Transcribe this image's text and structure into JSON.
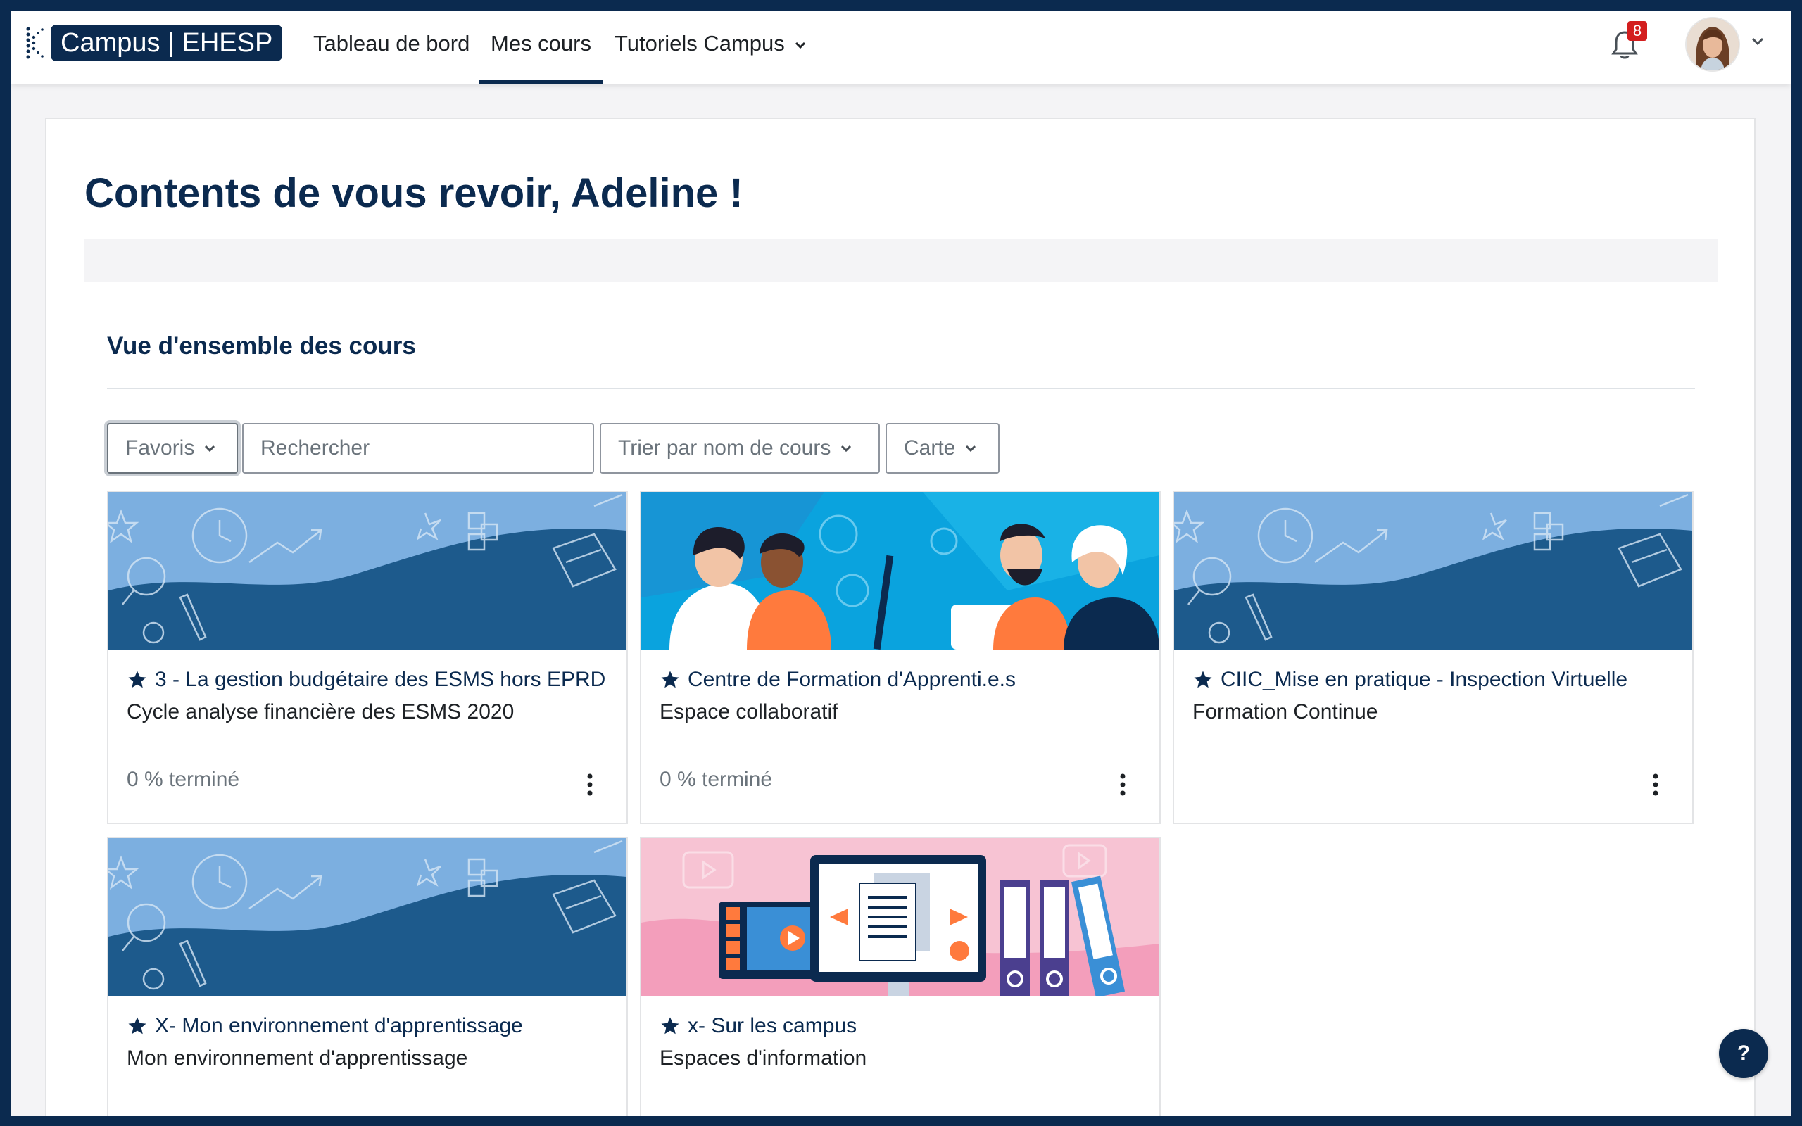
{
  "brand": {
    "logo_text": "Campus | EHESP"
  },
  "nav": {
    "items": [
      {
        "label": "Tableau de bord"
      },
      {
        "label": "Mes cours"
      },
      {
        "label": "Tutoriels Campus"
      }
    ],
    "notifications_count": "8"
  },
  "main": {
    "greeting": "Contents de vous revoir, Adeline !",
    "section_title": "Vue d'ensemble des cours",
    "filters": {
      "grouping": "Favoris",
      "search_placeholder": "Rechercher",
      "sort": "Trier par nom de cours",
      "view": "Carte"
    },
    "courses": [
      {
        "title": "3 - La gestion budgétaire des ESMS hors EPRD",
        "category": "Cycle analyse financière des ESMS 2020",
        "progress": "0 % terminé",
        "image": "default-pattern"
      },
      {
        "title": "Centre de Formation d'Apprenti.e.s",
        "category": "Espace collaboratif",
        "progress": "0 % terminé",
        "image": "people-illustration"
      },
      {
        "title": "CIIC_Mise en pratique - Inspection Virtuelle",
        "category": "Formation Continue",
        "progress": "",
        "image": "default-pattern"
      },
      {
        "title": "X- Mon environnement d'apprentissage",
        "category": "Mon environnement d'apprentissage",
        "progress": "",
        "image": "default-pattern"
      },
      {
        "title": "x- Sur les campus",
        "category": "Espaces d'information",
        "progress": "",
        "image": "media-illustration"
      }
    ]
  },
  "help": {
    "label": "?"
  },
  "colors": {
    "primary": "#0b2a4f",
    "accent_light": "#7cafe0",
    "accent_dark": "#1d5a8c",
    "badge": "#d31e1e"
  }
}
